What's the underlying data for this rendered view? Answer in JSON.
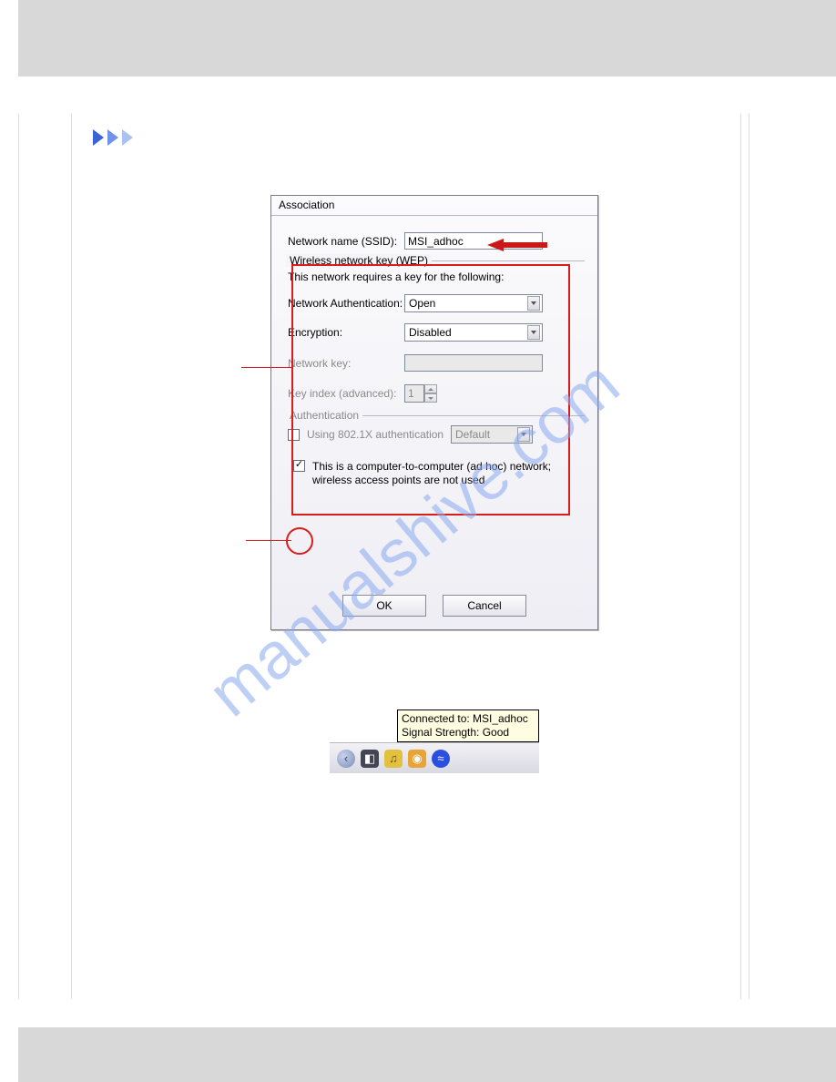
{
  "watermark": "manualshive.com",
  "dialog": {
    "title": "Association",
    "ssid_label": "Network name (SSID):",
    "ssid_value": "MSI_adhoc",
    "wep_group": "Wireless network key (WEP)",
    "wep_desc": "This network requires a key for the following:",
    "auth_label": "Network Authentication:",
    "auth_value": "Open",
    "enc_label": "Encryption:",
    "enc_value": "Disabled",
    "key_label": "Network key:",
    "key_value": "",
    "keyidx_label": "Key index (advanced):",
    "keyidx_value": "1",
    "authn_group": "Authentication",
    "use8021x_label": "Using 802.1X authentication",
    "authn_value": "Default",
    "adhoc_label": "This is a computer-to-computer (ad hoc) network; wireless access points are not used",
    "ok": "OK",
    "cancel": "Cancel"
  },
  "tooltip": {
    "line1": "Connected to: MSI_adhoc",
    "line2": "Signal Strength: Good"
  }
}
